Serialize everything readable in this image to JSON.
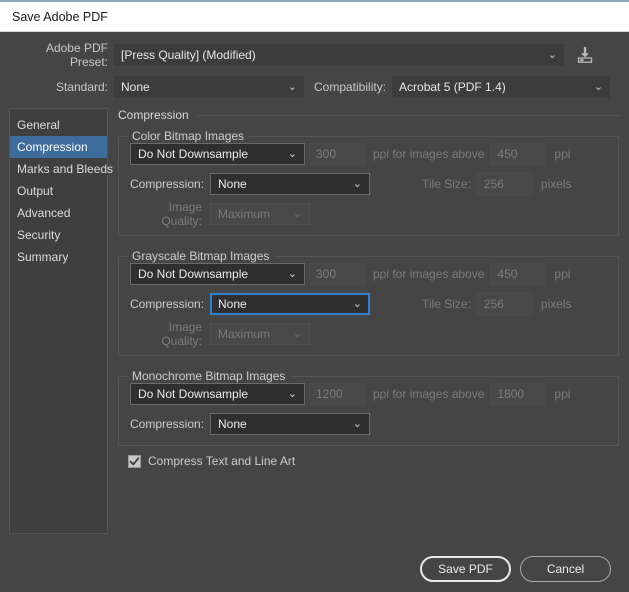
{
  "window": {
    "title": "Save Adobe PDF"
  },
  "top": {
    "preset_label": "Adobe PDF Preset:",
    "preset_value": "[Press Quality] (Modified)",
    "preset_save_icon": "save-to-disk-icon",
    "standard_label": "Standard:",
    "standard_value": "None",
    "compatibility_label": "Compatibility:",
    "compatibility_value": "Acrobat 5 (PDF 1.4)",
    "chevron": "chevron-down-icon"
  },
  "sidebar": {
    "items": [
      {
        "label": "General",
        "selected": false
      },
      {
        "label": "Compression",
        "selected": true
      },
      {
        "label": "Marks and Bleeds",
        "selected": false
      },
      {
        "label": "Output",
        "selected": false
      },
      {
        "label": "Advanced",
        "selected": false
      },
      {
        "label": "Security",
        "selected": false
      },
      {
        "label": "Summary",
        "selected": false
      }
    ]
  },
  "main": {
    "section_title": "Compression",
    "groups": {
      "color": {
        "legend": "Color Bitmap Images",
        "downsample_value": "Do Not Downsample",
        "ppi_value": "300",
        "ppi_mid_label": "ppi for images above",
        "threshold_value": "450",
        "ppi_suffix": "ppi",
        "compression_label": "Compression:",
        "compression_value": "None",
        "tile_label": "Tile Size:",
        "tile_value": "256",
        "tile_suffix": "pixels",
        "quality_label": "Image Quality:",
        "quality_value": "Maximum"
      },
      "grayscale": {
        "legend": "Grayscale Bitmap Images",
        "downsample_value": "Do Not Downsample",
        "ppi_value": "300",
        "ppi_mid_label": "ppi for images above",
        "threshold_value": "450",
        "ppi_suffix": "ppi",
        "compression_label": "Compression:",
        "compression_value": "None",
        "tile_label": "Tile Size:",
        "tile_value": "256",
        "tile_suffix": "pixels",
        "quality_label": "Image Quality:",
        "quality_value": "Maximum"
      },
      "monochrome": {
        "legend": "Monochrome Bitmap Images",
        "downsample_value": "Do Not Downsample",
        "ppi_value": "1200",
        "ppi_mid_label": "ppi for images above",
        "threshold_value": "1800",
        "ppi_suffix": "ppi",
        "compression_label": "Compression:",
        "compression_value": "None"
      }
    },
    "compress_text_label": "Compress Text and Line Art",
    "compress_text_checked": true,
    "check_glyph": "✔"
  },
  "footer": {
    "save_label": "Save PDF",
    "cancel_label": "Cancel"
  },
  "colors": {
    "dialog_bg": "#454545",
    "titlebar_bg": "#ffffff",
    "accent_top_rule": "#8ba6bf",
    "selection_blue": "#3e6c9c",
    "focus_blue": "#2f81d4",
    "field_border": "#6a6a6a",
    "disabled_text": "#7c7c7c"
  }
}
